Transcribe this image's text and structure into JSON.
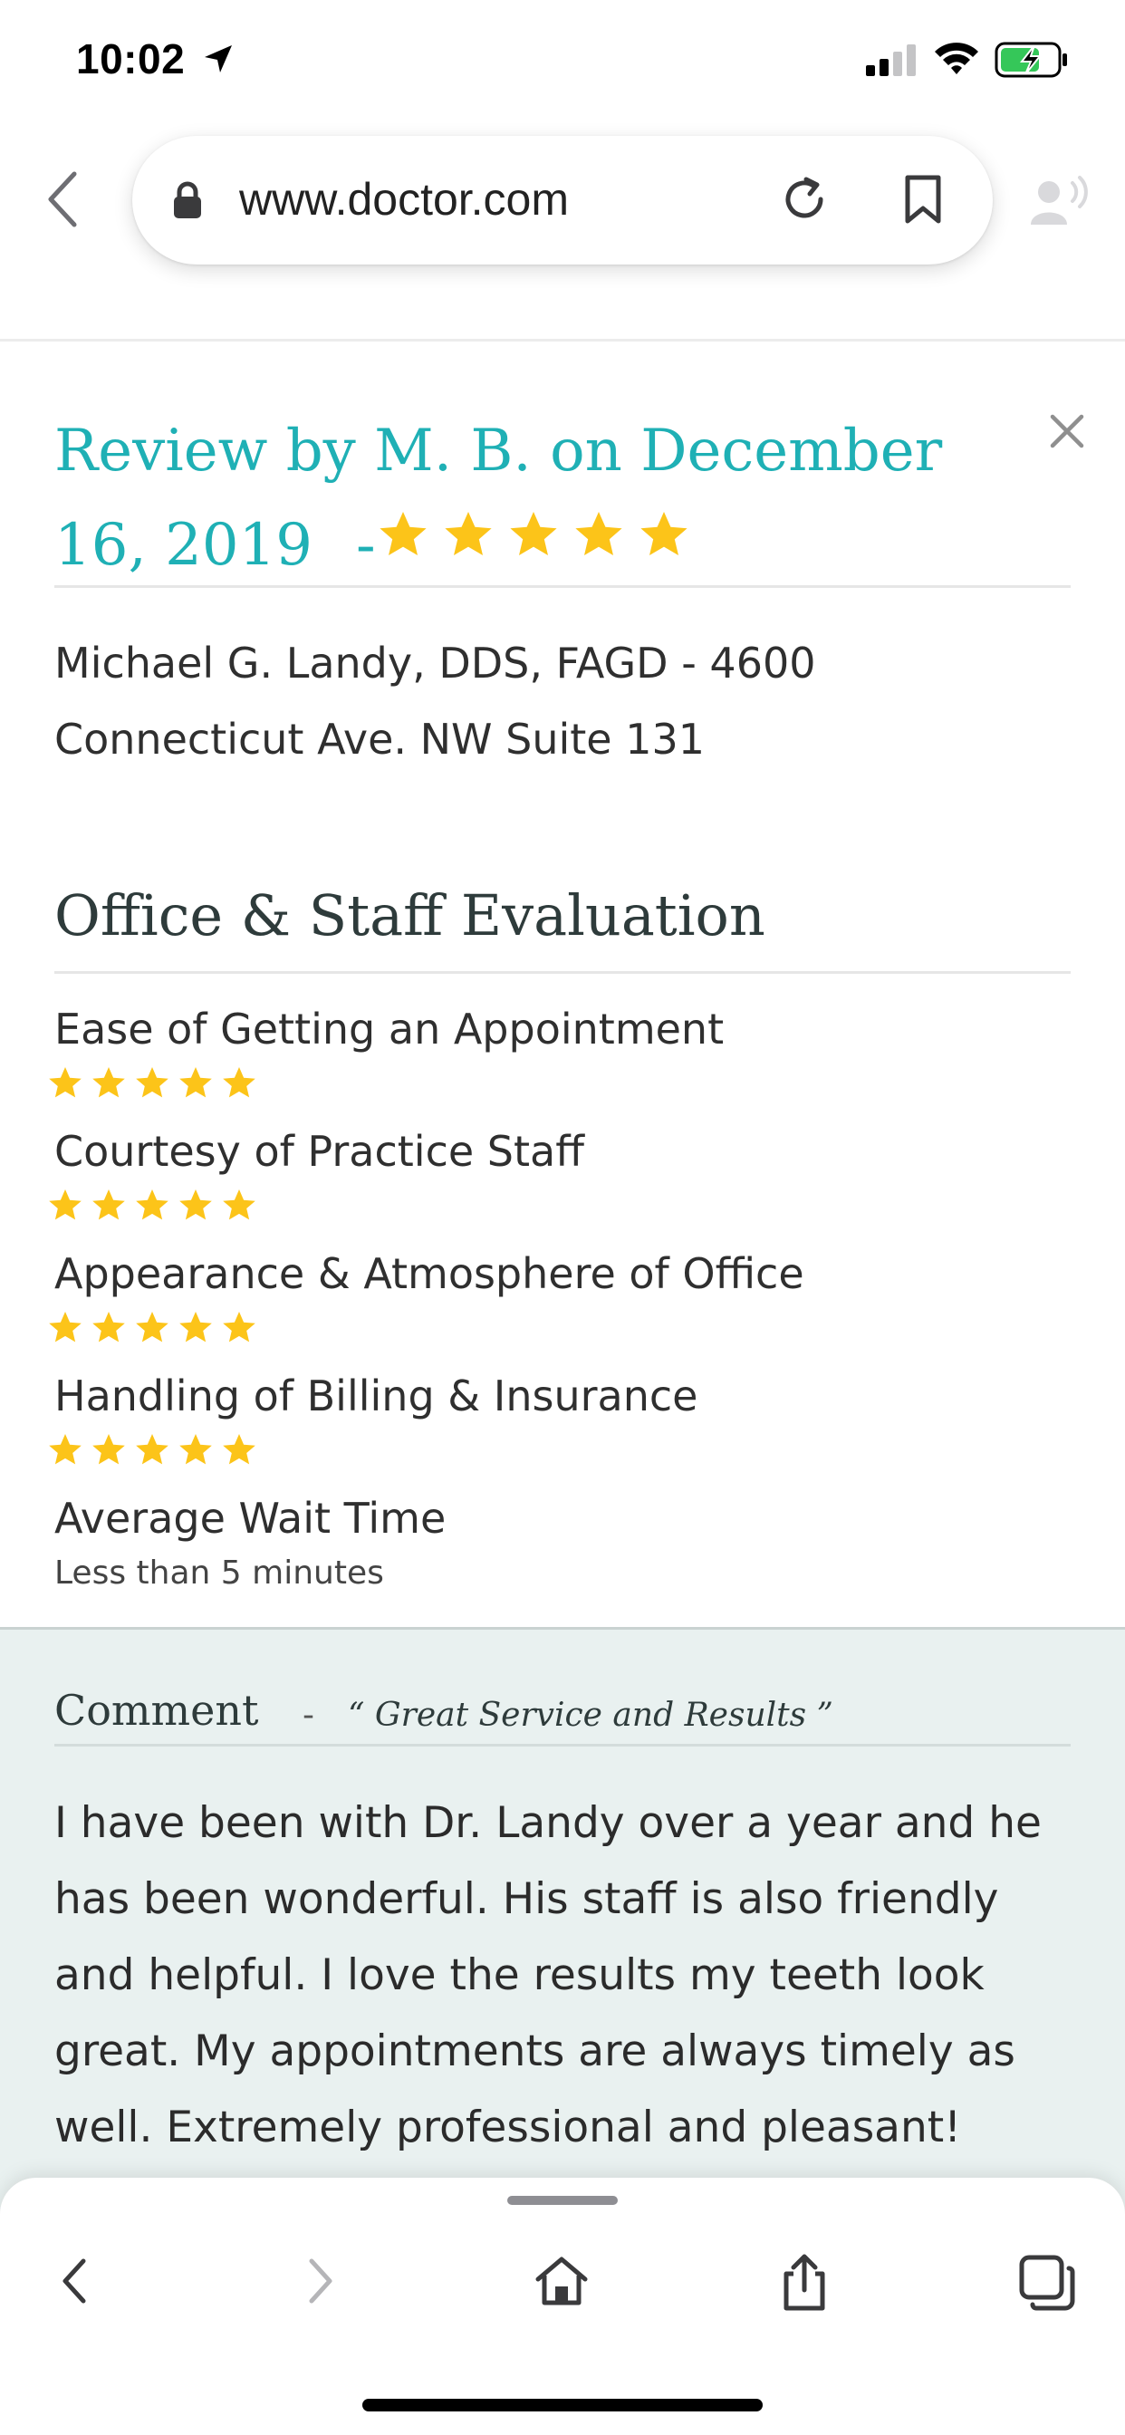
{
  "status_bar": {
    "time": "10:02"
  },
  "browser": {
    "url": "www.doctor.com"
  },
  "review": {
    "title": "Review by M. B. on December 16, 2019",
    "dash": "-",
    "rating": 5,
    "provider": "Michael G. Landy, DDS, FAGD - 4600 Connecticut Ave. NW Suite 131"
  },
  "evaluation": {
    "title": "Office & Staff Evaluation",
    "items": [
      {
        "label": "Ease of Getting an Appointment",
        "rating": 5
      },
      {
        "label": "Courtesy of Practice Staff",
        "rating": 5
      },
      {
        "label": "Appearance & Atmosphere of Office",
        "rating": 5
      },
      {
        "label": "Handling of Billing & Insurance",
        "rating": 5
      }
    ],
    "wait_label": "Average Wait Time",
    "wait_value": "Less than 5 minutes"
  },
  "comment": {
    "title": "Comment",
    "dash": "-",
    "quote": "“ Great Service and Results ”",
    "body": "I have been with Dr. Landy over a year and he has been wonderful. His staff is also friendly and helpful. I love the results my teeth look great. My appointments are always timely as well. Extremely professional and pleasant!"
  },
  "colors": {
    "accent": "#1fb0b5",
    "star": "#fcc419",
    "comment_bg": "#e9f1f0"
  }
}
